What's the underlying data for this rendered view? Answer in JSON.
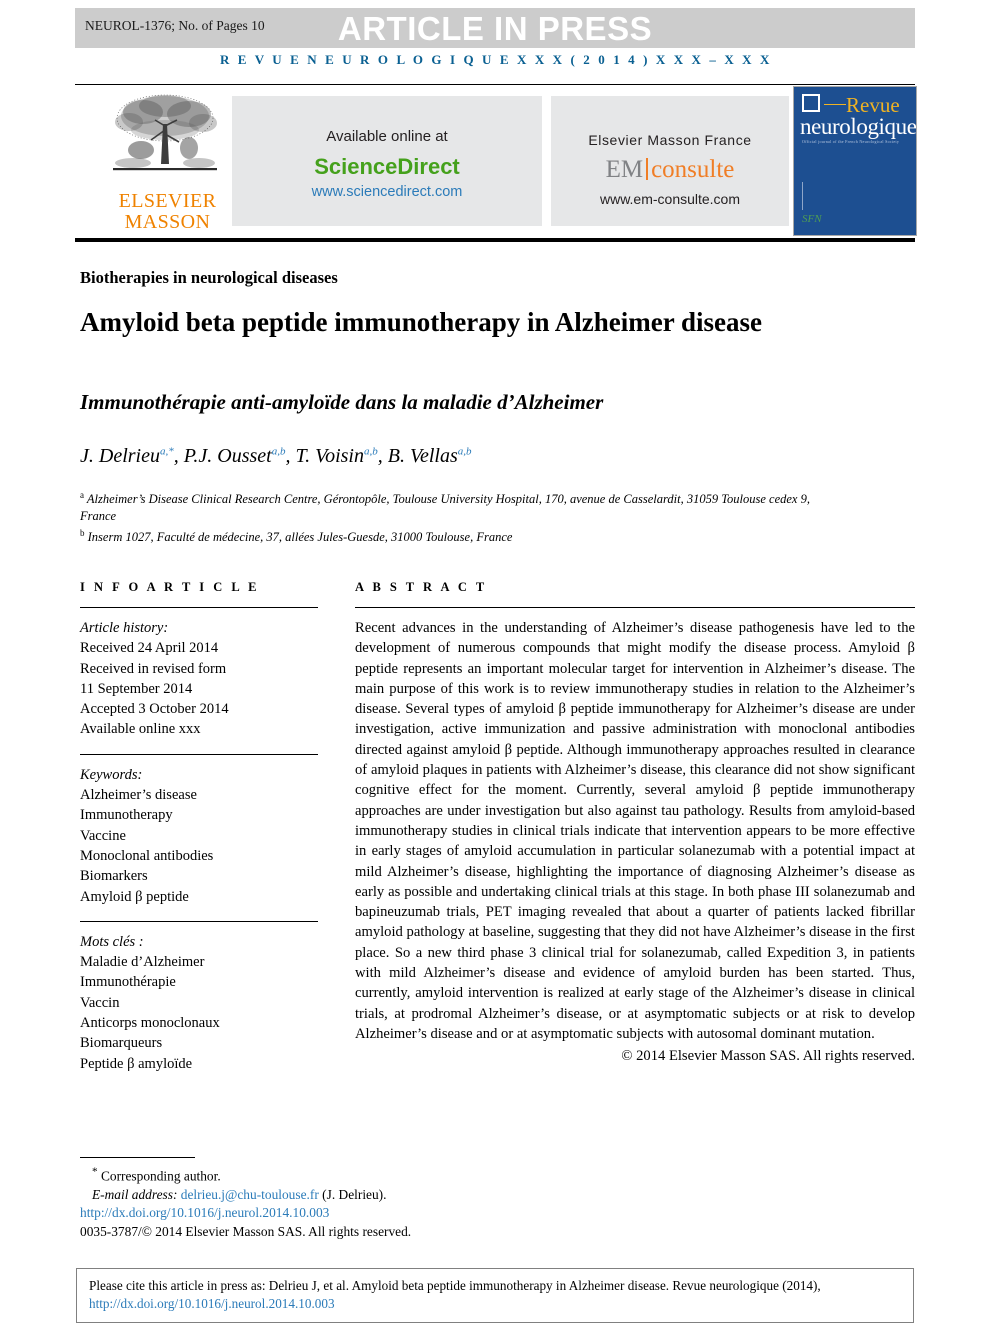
{
  "banner": {
    "manuscript_id": "NEUROL-1376; No. of Pages 10",
    "status": "ARTICLE IN PRESS"
  },
  "runhead": "R E V U E   N E U R O L O G I Q U E   X X X   ( 2 0 1 4 )   X X X – X X X",
  "masthead": {
    "publisher_logo_line1": "ELSEVIER",
    "publisher_logo_line2": "MASSON",
    "sciencedirect": {
      "available": "Available online at",
      "name": "ScienceDirect",
      "url": "www.sciencedirect.com"
    },
    "emconsulte": {
      "line1": "Elsevier Masson France",
      "logo_em": "EM",
      "logo_consulte": "consulte",
      "url": "www.em-consulte.com"
    },
    "cover": {
      "title_top": "Revue",
      "title_bottom": "neurologique",
      "subtitle": "Official journal of the French Neurological Society",
      "society_mark": "SFN"
    }
  },
  "article": {
    "section": "Biotherapies in neurological diseases",
    "title": "Amyloid beta peptide immunotherapy in Alzheimer disease",
    "subtitle": "Immunothérapie anti-amyloïde dans la maladie d’Alzheimer",
    "authors": [
      {
        "name": "J. Delrieu",
        "sup": "a,*"
      },
      {
        "name": "P.J. Ousset",
        "sup": "a,b"
      },
      {
        "name": "T. Voisin",
        "sup": "a,b"
      },
      {
        "name": "B. Vellas",
        "sup": "a,b"
      }
    ],
    "affiliations": [
      {
        "mark": "a",
        "text": "Alzheimer’s Disease Clinical Research Centre, Gérontopôle, Toulouse University Hospital, 170, avenue de Casselardit, 31059 Toulouse cedex 9, France"
      },
      {
        "mark": "b",
        "text": "Inserm 1027, Faculté de médecine, 37, allées Jules-Guesde, 31000 Toulouse, France"
      }
    ]
  },
  "info": {
    "heading": "I N F O   A R T I C L E",
    "history_label": "Article history:",
    "history": [
      "Received 24 April 2014",
      "Received in revised form",
      "11 September 2014",
      "Accepted 3 October 2014",
      "Available online xxx"
    ],
    "keywords_label": "Keywords:",
    "keywords": [
      "Alzheimer’s disease",
      "Immunotherapy",
      "Vaccine",
      "Monoclonal antibodies",
      "Biomarkers",
      "Amyloid β peptide"
    ],
    "motscles_label": "Mots clés :",
    "motscles": [
      "Maladie d’Alzheimer",
      "Immunothérapie",
      "Vaccin",
      "Anticorps monoclonaux",
      "Biomarqueurs",
      "Peptide β amyloïde"
    ]
  },
  "abstract": {
    "heading": "A B S T R A C T",
    "body": "Recent advances in the understanding of Alzheimer’s disease pathogenesis have led to the development of numerous compounds that might modify the disease process. Amyloid β peptide represents an important molecular target for intervention in Alzheimer’s disease. The main purpose of this work is to review immunotherapy studies in relation to the Alzheimer’s disease. Several types of amyloid β peptide immunotherapy for Alzheimer’s disease are under investigation, active immunization and passive administration with monoclonal antibodies directed against amyloid β peptide. Although immunotherapy approaches resulted in clearance of amyloid plaques in patients with Alzheimer’s disease, this clearance did not show significant cognitive effect for the moment. Currently, several amyloid β peptide immunotherapy approaches are under investigation but also against tau pathology. Results from amyloid-based immunotherapy studies in clinical trials indicate that intervention appears to be more effective in early stages of amyloid accumulation in particular solanezumab with a potential impact at mild Alzheimer’s disease, highlighting the importance of diagnosing Alzheimer’s disease as early as possible and undertaking clinical trials at this stage. In both phase III solanezumab and bapineuzumab trials, PET imaging revealed that about a quarter of patients lacked fibrillar amyloid pathology at baseline, suggesting that they did not have Alzheimer’s disease in the first place. So a new third phase 3 clinical trial for solanezumab, called Expedition 3, in patients with mild Alzheimer’s disease and evidence of amyloid burden has been started. Thus, currently, amyloid intervention is realized at early stage of the Alzheimer’s disease in clinical trials, at prodromal Alzheimer’s disease, or at asymptomatic subjects or at risk to develop Alzheimer’s disease and or at asymptomatic subjects with autosomal dominant mutation.",
    "copyright": "© 2014 Elsevier Masson SAS. All rights reserved."
  },
  "footnotes": {
    "corresponding": "Corresponding author.",
    "email_label": "E-mail address:",
    "email": "delrieu.j@chu-toulouse.fr",
    "email_attrib": "(J. Delrieu).",
    "doi": "http://dx.doi.org/10.1016/j.neurol.2014.10.003",
    "issn_line": "0035-3787/© 2014 Elsevier Masson SAS. All rights reserved."
  },
  "citation": {
    "text": "Please cite this article in press as: Delrieu J, et al. Amyloid beta peptide immunotherapy in Alzheimer disease. Revue neurologique (2014), ",
    "link": "http://dx.doi.org/10.1016/j.neurol.2014.10.003"
  },
  "colors": {
    "banner_grey": "#cccccc",
    "runhead_blue": "#0a6092",
    "sciencedirect_green": "#45a11c",
    "link_blue": "#2b7bb9",
    "elsevier_orange": "#ef8200",
    "cover_blue": "#1d4f91"
  }
}
